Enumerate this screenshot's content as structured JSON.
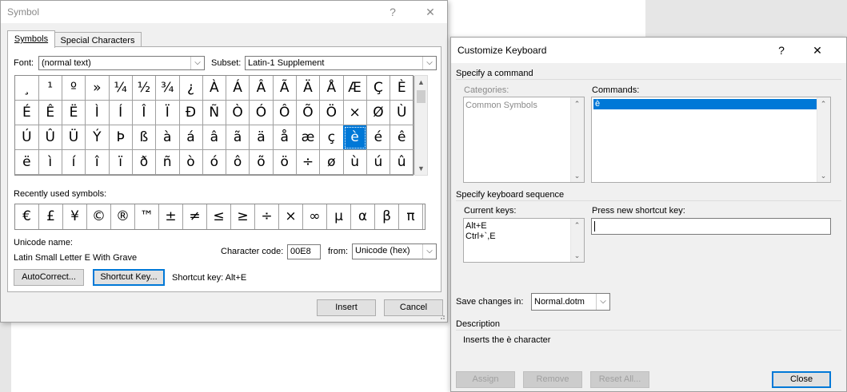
{
  "symbol_dialog": {
    "title": "Symbol",
    "help": "?",
    "close": "✕",
    "tabs": [
      {
        "label": "Symbols",
        "active": true
      },
      {
        "label": "Special Characters",
        "active": false
      }
    ],
    "font_label": "Font:",
    "font_value": "(normal text)",
    "subset_label": "Subset:",
    "subset_value": "Latin-1 Supplement",
    "grid": [
      [
        "¸",
        "¹",
        "º",
        "»",
        "¼",
        "½",
        "¾",
        "¿",
        "À",
        "Á",
        "Â",
        "Ã",
        "Ä",
        "Å",
        "Æ",
        "Ç",
        "È"
      ],
      [
        "É",
        "Ê",
        "Ë",
        "Ì",
        "Í",
        "Î",
        "Ï",
        "Ð",
        "Ñ",
        "Ò",
        "Ó",
        "Ô",
        "Õ",
        "Ö",
        "×",
        "Ø",
        "Ù"
      ],
      [
        "Ú",
        "Û",
        "Ü",
        "Ý",
        "Þ",
        "ß",
        "à",
        "á",
        "â",
        "ã",
        "ä",
        "å",
        "æ",
        "ç",
        "è",
        "é",
        "ê"
      ],
      [
        "ë",
        "ì",
        "í",
        "î",
        "ï",
        "ð",
        "ñ",
        "ò",
        "ó",
        "ô",
        "õ",
        "ö",
        "÷",
        "ø",
        "ù",
        "ú",
        "û"
      ]
    ],
    "selected_symbol": "è",
    "recent_label": "Recently used symbols:",
    "recent": [
      "€",
      "£",
      "¥",
      "©",
      "®",
      "™",
      "±",
      "≠",
      "≤",
      "≥",
      "÷",
      "×",
      "∞",
      "µ",
      "α",
      "β",
      "π"
    ],
    "unicode_name_label": "Unicode name:",
    "unicode_name_value": "Latin Small Letter E With Grave",
    "char_code_label": "Character code:",
    "char_code_value": "00E8",
    "from_label": "from:",
    "from_value": "Unicode (hex)",
    "autocorrect_label": "AutoCorrect...",
    "shortcut_key_button": "Shortcut Key...",
    "shortcut_key_text": "Shortcut key: Alt+E",
    "insert_label": "Insert",
    "cancel_label": "Cancel"
  },
  "keyboard_dialog": {
    "title": "Customize Keyboard",
    "help": "?",
    "close": "✕",
    "specify_command_label": "Specify a command",
    "categories_label": "Categories:",
    "categories": [
      "Common Symbols"
    ],
    "commands_label": "Commands:",
    "commands": [
      "è"
    ],
    "specify_sequence_label": "Specify keyboard sequence",
    "current_keys_label": "Current keys:",
    "current_keys": [
      "Alt+E",
      "Ctrl+`,E"
    ],
    "press_new_label": "Press new shortcut key:",
    "press_new_value": "",
    "save_changes_label": "Save changes in:",
    "save_changes_value": "Normal.dotm",
    "description_label": "Description",
    "description_value": "Inserts the è character",
    "assign_label": "Assign",
    "remove_label": "Remove",
    "reset_all_label": "Reset All...",
    "close_label": "Close"
  },
  "colors": {
    "selection": "#0078d7",
    "dialog_bg": "#f0f0f0"
  }
}
